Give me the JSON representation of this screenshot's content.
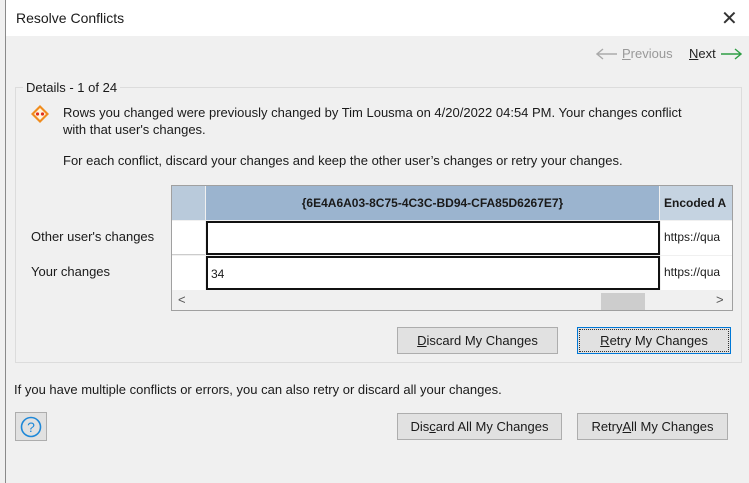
{
  "title": "Resolve Conflicts",
  "nav": {
    "previous": [
      "",
      "P",
      "revious"
    ],
    "next": [
      "",
      "N",
      "ext"
    ]
  },
  "details_label": "Details - 1 of 24",
  "message_line1": "Rows you changed were previously changed by Tim Lousma on 4/20/2022 04:54 PM. Your changes conflict",
  "message_line2": "with that user's changes.",
  "instruction": "For each conflict, discard your changes and keep the other user’s changes or retry your changes.",
  "table": {
    "columns": [
      "{6E4A6A03-8C75-4C3C-BD94-CFA85D6267E7}",
      "Encoded A"
    ],
    "rows": [
      {
        "label": "Other user's changes",
        "values": [
          "",
          "https://qua"
        ]
      },
      {
        "label": "Your changes",
        "values": [
          "34",
          "https://qua"
        ]
      }
    ]
  },
  "buttons": {
    "discard": [
      "",
      "D",
      "iscard My Changes"
    ],
    "retry": [
      "",
      "R",
      "etry My Changes"
    ],
    "discard_all": [
      "Dis",
      "c",
      "ard All My Changes"
    ],
    "retry_all": [
      "Retry ",
      "A",
      "ll My Changes"
    ]
  },
  "footer_text": "If you have multiple conflicts or errors, you can also retry or discard all your changes.",
  "colors": {
    "header": "#9bb4cf",
    "accent": "#0078d7",
    "next_arrow": "#2e9e44",
    "warning": "#f08c1e"
  }
}
